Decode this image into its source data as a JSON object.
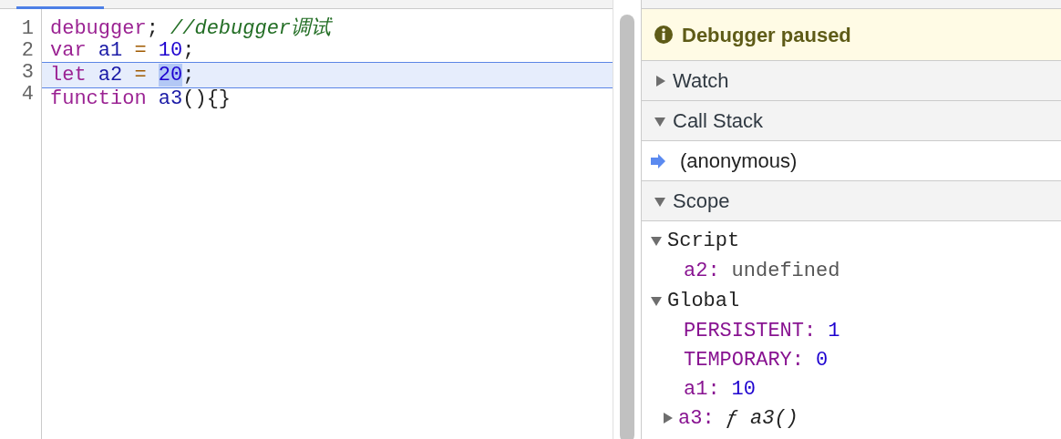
{
  "editor": {
    "lines": [
      {
        "number": "1",
        "paused": false,
        "tokens": [
          {
            "text": "debugger",
            "kind": "keyword"
          },
          {
            "text": "; ",
            "kind": "punct"
          },
          {
            "text": "//debugger调试",
            "kind": "comment"
          }
        ]
      },
      {
        "number": "2",
        "paused": false,
        "tokens": [
          {
            "text": "var ",
            "kind": "keyword"
          },
          {
            "text": "a1 ",
            "kind": "variable"
          },
          {
            "text": "= ",
            "kind": "operator"
          },
          {
            "text": "10",
            "kind": "number"
          },
          {
            "text": ";",
            "kind": "punct"
          }
        ]
      },
      {
        "number": "3",
        "paused": true,
        "tokens": [
          {
            "text": "let ",
            "kind": "keyword"
          },
          {
            "text": "a2 ",
            "kind": "variable"
          },
          {
            "text": "= ",
            "kind": "operator"
          },
          {
            "text": "20",
            "kind": "number",
            "selected": true
          },
          {
            "text": ";",
            "kind": "punct"
          }
        ]
      },
      {
        "number": "4",
        "paused": false,
        "tokens": [
          {
            "text": "function ",
            "kind": "keyword"
          },
          {
            "text": "a3",
            "kind": "variable"
          },
          {
            "text": "(){}",
            "kind": "punct"
          }
        ]
      }
    ]
  },
  "banner": {
    "text": "Debugger paused"
  },
  "sections": [
    {
      "title": "Watch",
      "expanded": false
    },
    {
      "title": "Call Stack",
      "expanded": true,
      "frames": [
        {
          "name": "(anonymous)",
          "selected": true
        }
      ]
    },
    {
      "title": "Scope",
      "expanded": true,
      "scopes": [
        {
          "name": "Script",
          "expanded": true,
          "children": [
            {
              "key": "a2:",
              "value": "undefined",
              "kind": "undefined"
            }
          ]
        },
        {
          "name": "Global",
          "expanded": true,
          "children": [
            {
              "key": "PERSISTENT:",
              "value": "1",
              "kind": "number"
            },
            {
              "key": "TEMPORARY:",
              "value": "0",
              "kind": "number"
            },
            {
              "key": "a1:",
              "value": "10",
              "kind": "number"
            },
            {
              "key": "a3:",
              "value": "ƒ a3()",
              "kind": "function",
              "expanded": false
            }
          ]
        }
      ]
    }
  ]
}
